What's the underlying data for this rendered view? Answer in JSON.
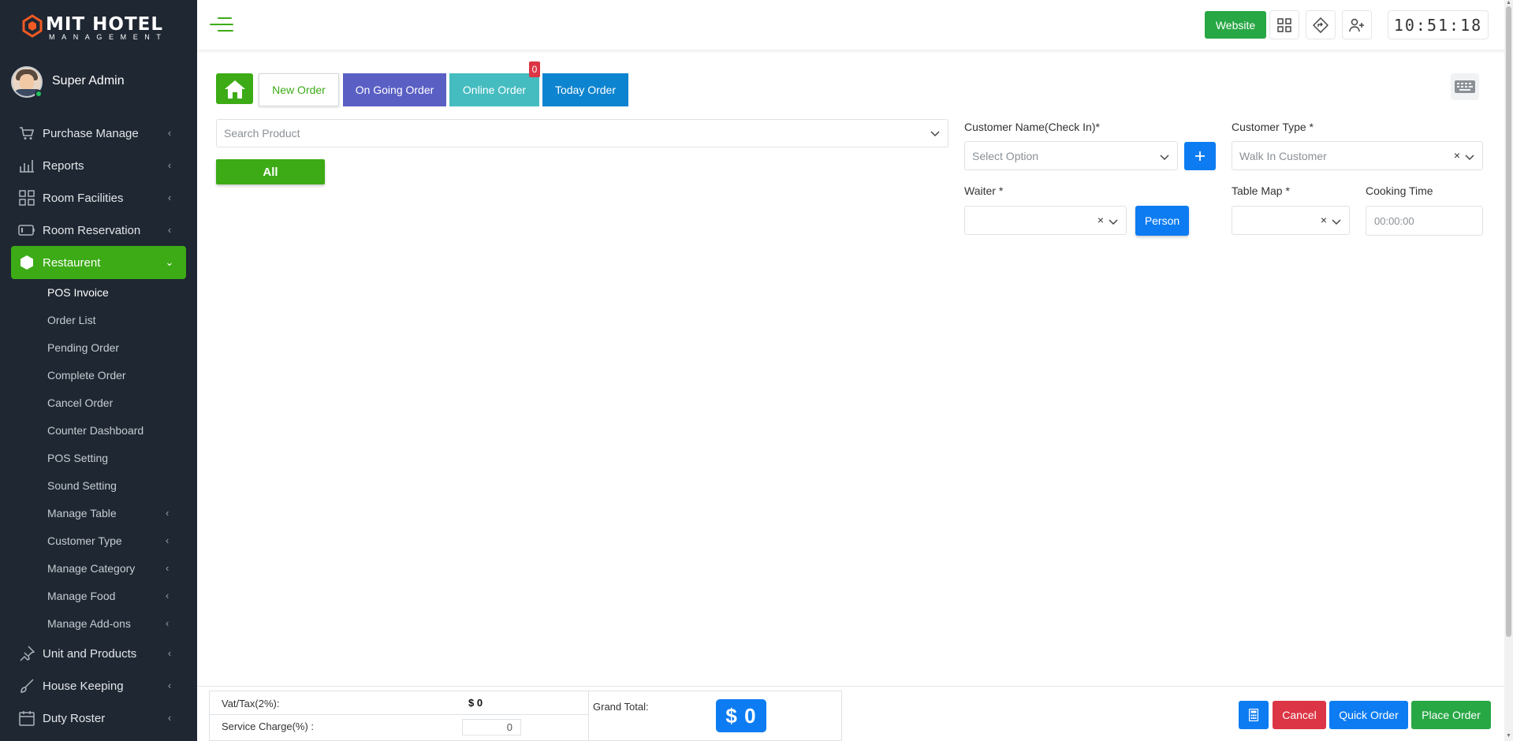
{
  "brand": {
    "name": "MIT HOTEL",
    "tagline": "MANAGEMENT"
  },
  "user": {
    "name": "Super Admin"
  },
  "sidebar": {
    "items": [
      {
        "label": "Purchase Manage",
        "icon": "cart-icon"
      },
      {
        "label": "Reports",
        "icon": "bar-chart-icon"
      },
      {
        "label": "Room Facilities",
        "icon": "grid-icon"
      },
      {
        "label": "Room Reservation",
        "icon": "battery-icon"
      },
      {
        "label": "Restaurent",
        "icon": "hexagon-icon"
      }
    ],
    "sub_items": [
      {
        "label": "POS Invoice"
      },
      {
        "label": "Order List"
      },
      {
        "label": "Pending Order"
      },
      {
        "label": "Complete Order"
      },
      {
        "label": "Cancel Order"
      },
      {
        "label": "Counter Dashboard"
      },
      {
        "label": "POS Setting"
      },
      {
        "label": "Sound Setting"
      },
      {
        "label": "Manage Table"
      },
      {
        "label": "Customer Type"
      },
      {
        "label": "Manage Category"
      },
      {
        "label": "Manage Food"
      },
      {
        "label": "Manage Add-ons"
      }
    ],
    "bottom_items": [
      {
        "label": "Unit and Products",
        "icon": "pin-icon"
      },
      {
        "label": "House Keeping",
        "icon": "brush-icon"
      },
      {
        "label": "Duty Roster",
        "icon": "calendar-icon"
      }
    ]
  },
  "header": {
    "website_label": "Website",
    "clock": "10:51:18"
  },
  "tabs": {
    "new_order": "New Order",
    "ongoing_order": "On Going Order",
    "online_order": "Online Order",
    "online_badge": "0",
    "today_order": "Today Order"
  },
  "search": {
    "placeholder": "Search Product"
  },
  "category": {
    "all_label": "All"
  },
  "form": {
    "customer_name_label": "Customer Name(Check In)*",
    "customer_name_placeholder": "Select Option",
    "customer_type_label": "Customer Type *",
    "customer_type_value": "Walk In Customer",
    "waiter_label": "Waiter *",
    "person_label": "Person",
    "table_map_label": "Table Map *",
    "cooking_time_label": "Cooking Time",
    "cooking_time_value": "00:00:00"
  },
  "totals": {
    "vat_label": "Vat/Tax(2%):",
    "vat_value": "$ 0",
    "service_label": "Service Charge(%) :",
    "service_value": "0",
    "grand_label": "Grand Total:",
    "grand_value": "$ 0"
  },
  "actions": {
    "cancel": "Cancel",
    "quick_order": "Quick Order",
    "place_order": "Place Order"
  },
  "colors": {
    "sidebar_bg": "#1f2732",
    "accent_green": "#3cab16",
    "blue": "#0d7cf2",
    "red": "#dc3545"
  }
}
